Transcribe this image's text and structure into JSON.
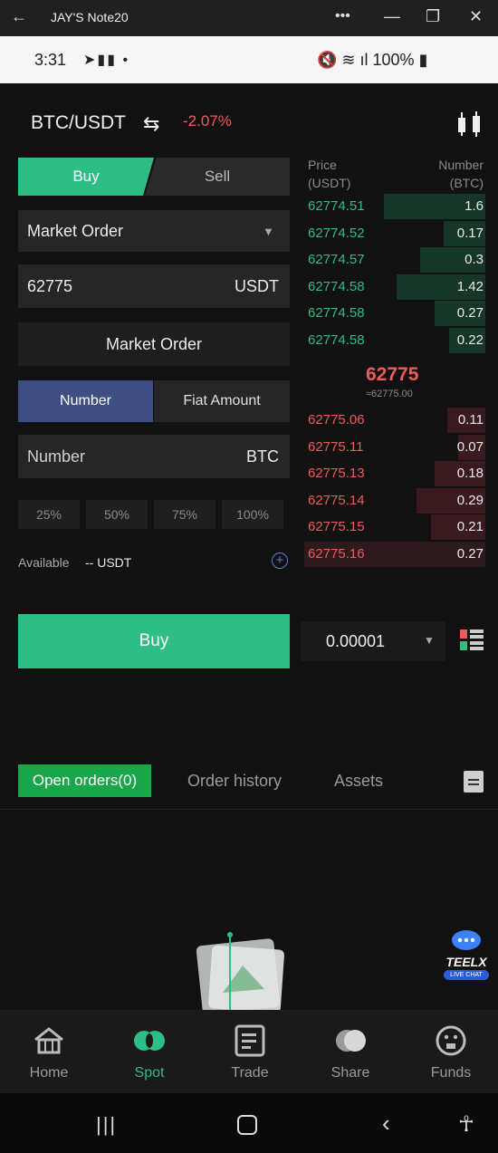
{
  "window": {
    "title": "JAY'S Note20",
    "back_icon": "arrow-left-icon",
    "menu_icon": "more-horizontal-icon",
    "minimize": "minimize-icon",
    "restore": "restore-icon",
    "close": "close-icon"
  },
  "status_bar": {
    "time": "3:31",
    "battery": "100%"
  },
  "header": {
    "pair": "BTC/USDT",
    "change": "-2.07%"
  },
  "trade_tabs": {
    "buy": "Buy",
    "sell": "Sell"
  },
  "order_type": {
    "value": "Market Order"
  },
  "price_field": {
    "value": "62775",
    "unit": "USDT"
  },
  "market_label": "Market Order",
  "amount_tabs": {
    "number": "Number",
    "fiat": "Fiat Amount"
  },
  "number_field": {
    "placeholder": "Number",
    "unit": "BTC"
  },
  "percent_buttons": [
    "25%",
    "50%",
    "75%",
    "100%"
  ],
  "available": {
    "label": "Available",
    "value": "-- USDT"
  },
  "buy_button": "Buy",
  "quantity_step": "0.00001",
  "orderbook": {
    "price_header": "Price",
    "price_unit": "(USDT)",
    "number_header": "Number",
    "number_unit": "(BTC)",
    "bids": [
      {
        "price": "62774.51",
        "number": "1.6"
      },
      {
        "price": "62774.52",
        "number": "0.17"
      },
      {
        "price": "62774.57",
        "number": "0.3"
      },
      {
        "price": "62774.58",
        "number": "1.42"
      },
      {
        "price": "62774.58",
        "number": "0.27"
      },
      {
        "price": "62774.58",
        "number": "0.22"
      }
    ],
    "last_price": "62775",
    "last_price_equiv": "≈62775.00",
    "asks": [
      {
        "price": "62775.06",
        "number": "0.11"
      },
      {
        "price": "62775.11",
        "number": "0.07"
      },
      {
        "price": "62775.13",
        "number": "0.18"
      },
      {
        "price": "62775.14",
        "number": "0.29"
      },
      {
        "price": "62775.15",
        "number": "0.21"
      },
      {
        "price": "62775.16",
        "number": "0.27"
      }
    ]
  },
  "orders_tabs": {
    "open": "Open orders(0)",
    "history": "Order history",
    "assets": "Assets"
  },
  "chat_widget": {
    "line1": "TEELX",
    "line2": "LIVE CHAT"
  },
  "bottom_nav": [
    {
      "label": "Home",
      "icon": "home-icon",
      "active": false
    },
    {
      "label": "Spot",
      "icon": "spot-icon",
      "active": true
    },
    {
      "label": "Trade",
      "icon": "trade-icon",
      "active": false
    },
    {
      "label": "Share",
      "icon": "share-icon",
      "active": false
    },
    {
      "label": "Funds",
      "icon": "funds-icon",
      "active": false
    }
  ],
  "colors": {
    "accent": "#2ebd85",
    "down": "#ef5b5b",
    "bg": "#111111"
  }
}
